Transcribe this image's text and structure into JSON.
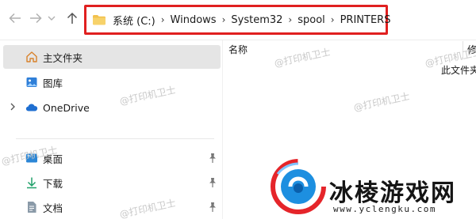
{
  "address_bar": {
    "crumbs": [
      "系统 (C:)",
      "Windows",
      "System32",
      "spool",
      "PRINTERS"
    ],
    "separator": "›"
  },
  "sidebar": {
    "items": [
      {
        "label": "主文件夹",
        "icon": "home-icon",
        "selected": true
      },
      {
        "label": "图库",
        "icon": "gallery-icon"
      },
      {
        "label": "OneDrive",
        "icon": "onedrive-icon",
        "expandable": true
      },
      {
        "label": "桌面",
        "icon": "desktop-icon",
        "pinned": true
      },
      {
        "label": "下载",
        "icon": "download-icon",
        "pinned": true
      },
      {
        "label": "文档",
        "icon": "documents-icon",
        "pinned": true
      }
    ]
  },
  "content": {
    "column_name": "名称",
    "column_partial": "修",
    "empty_text": "此文件夹"
  },
  "watermark": {
    "text": "@打印机卫士"
  },
  "logo": {
    "title": "冰棱游戏网",
    "url": "www.yclengku.com"
  },
  "colors": {
    "highlight": "#e02020",
    "selected_bg": "#e5e5e5",
    "folder": "#f2c14e",
    "accent": "#2a7de0"
  }
}
